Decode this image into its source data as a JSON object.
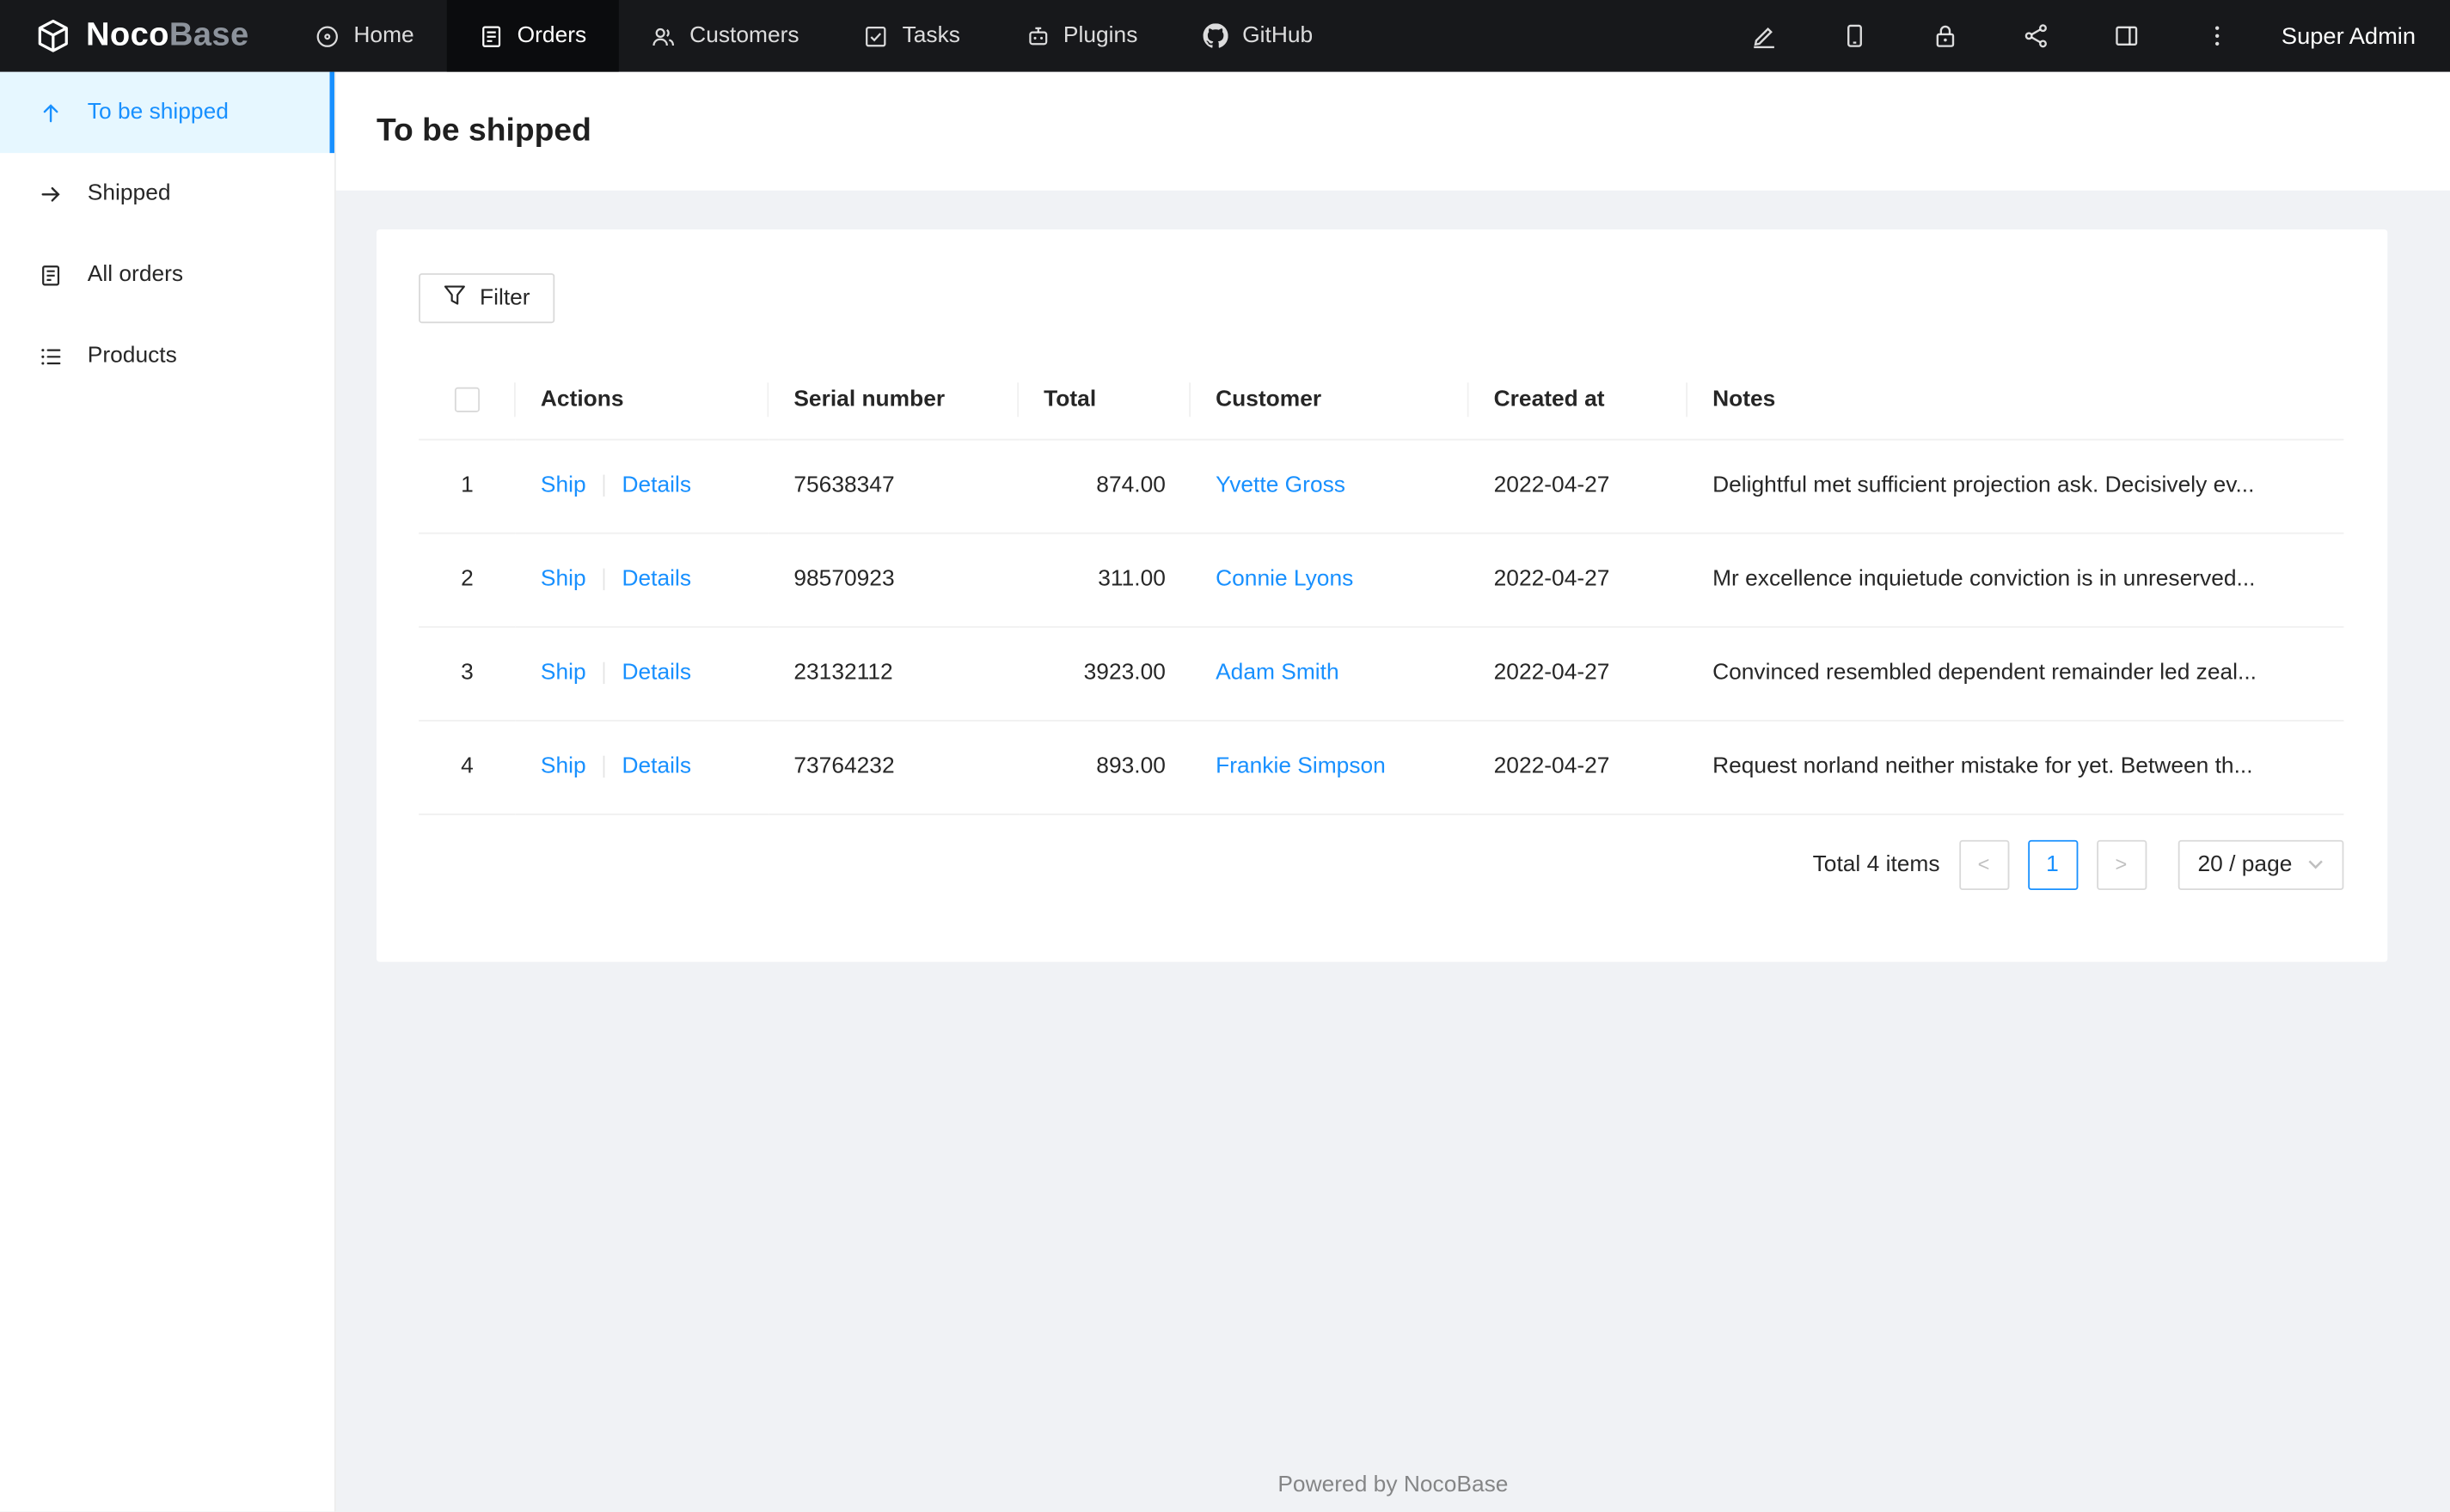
{
  "brand": {
    "name_bold": "Noco",
    "name_light": "Base"
  },
  "topnav": {
    "items": [
      {
        "label": "Home",
        "icon": "home-icon",
        "active": false
      },
      {
        "label": "Orders",
        "icon": "orders-icon",
        "active": true
      },
      {
        "label": "Customers",
        "icon": "customers-icon",
        "active": false
      },
      {
        "label": "Tasks",
        "icon": "tasks-icon",
        "active": false
      },
      {
        "label": "Plugins",
        "icon": "plugins-icon",
        "active": false
      },
      {
        "label": "GitHub",
        "icon": "github-icon",
        "active": false
      }
    ],
    "tools": [
      "highlighter-icon",
      "mobile-icon",
      "lock-icon",
      "share-icon",
      "layout-icon",
      "more-icon"
    ],
    "user": "Super Admin"
  },
  "sidebar": {
    "items": [
      {
        "label": "To be shipped",
        "icon": "arrow-up-icon",
        "active": true
      },
      {
        "label": "Shipped",
        "icon": "arrow-right-icon",
        "active": false
      },
      {
        "label": "All orders",
        "icon": "file-icon",
        "active": false
      },
      {
        "label": "Products",
        "icon": "list-icon",
        "active": false
      }
    ]
  },
  "page": {
    "title": "To be shipped"
  },
  "toolbar": {
    "filter_label": "Filter"
  },
  "table": {
    "columns": [
      "Actions",
      "Serial number",
      "Total",
      "Customer",
      "Created at",
      "Notes"
    ],
    "action_labels": {
      "ship": "Ship",
      "details": "Details"
    },
    "rows": [
      {
        "index": "1",
        "serial": "75638347",
        "total": "874.00",
        "customer": "Yvette Gross",
        "created_at": "2022-04-27",
        "notes": "Delightful met sufficient projection ask. Decisively ev..."
      },
      {
        "index": "2",
        "serial": "98570923",
        "total": "311.00",
        "customer": "Connie Lyons",
        "created_at": "2022-04-27",
        "notes": "Mr excellence inquietude conviction is in unreserved..."
      },
      {
        "index": "3",
        "serial": "23132112",
        "total": "3923.00",
        "customer": "Adam Smith",
        "created_at": "2022-04-27",
        "notes": "Convinced resembled dependent remainder led zeal..."
      },
      {
        "index": "4",
        "serial": "73764232",
        "total": "893.00",
        "customer": "Frankie Simpson",
        "created_at": "2022-04-27",
        "notes": "Request norland neither mistake for yet. Between th..."
      }
    ]
  },
  "pagination": {
    "total_text": "Total 4 items",
    "prev": "<",
    "current_page": "1",
    "next": ">",
    "page_size": "20 / page"
  },
  "footer": {
    "text": "Powered by NocoBase"
  },
  "colors": {
    "accent": "#1890ff",
    "navbar_bg": "#17181b",
    "active_item_bg": "#e6f7ff",
    "page_bg": "#f0f2f5"
  }
}
